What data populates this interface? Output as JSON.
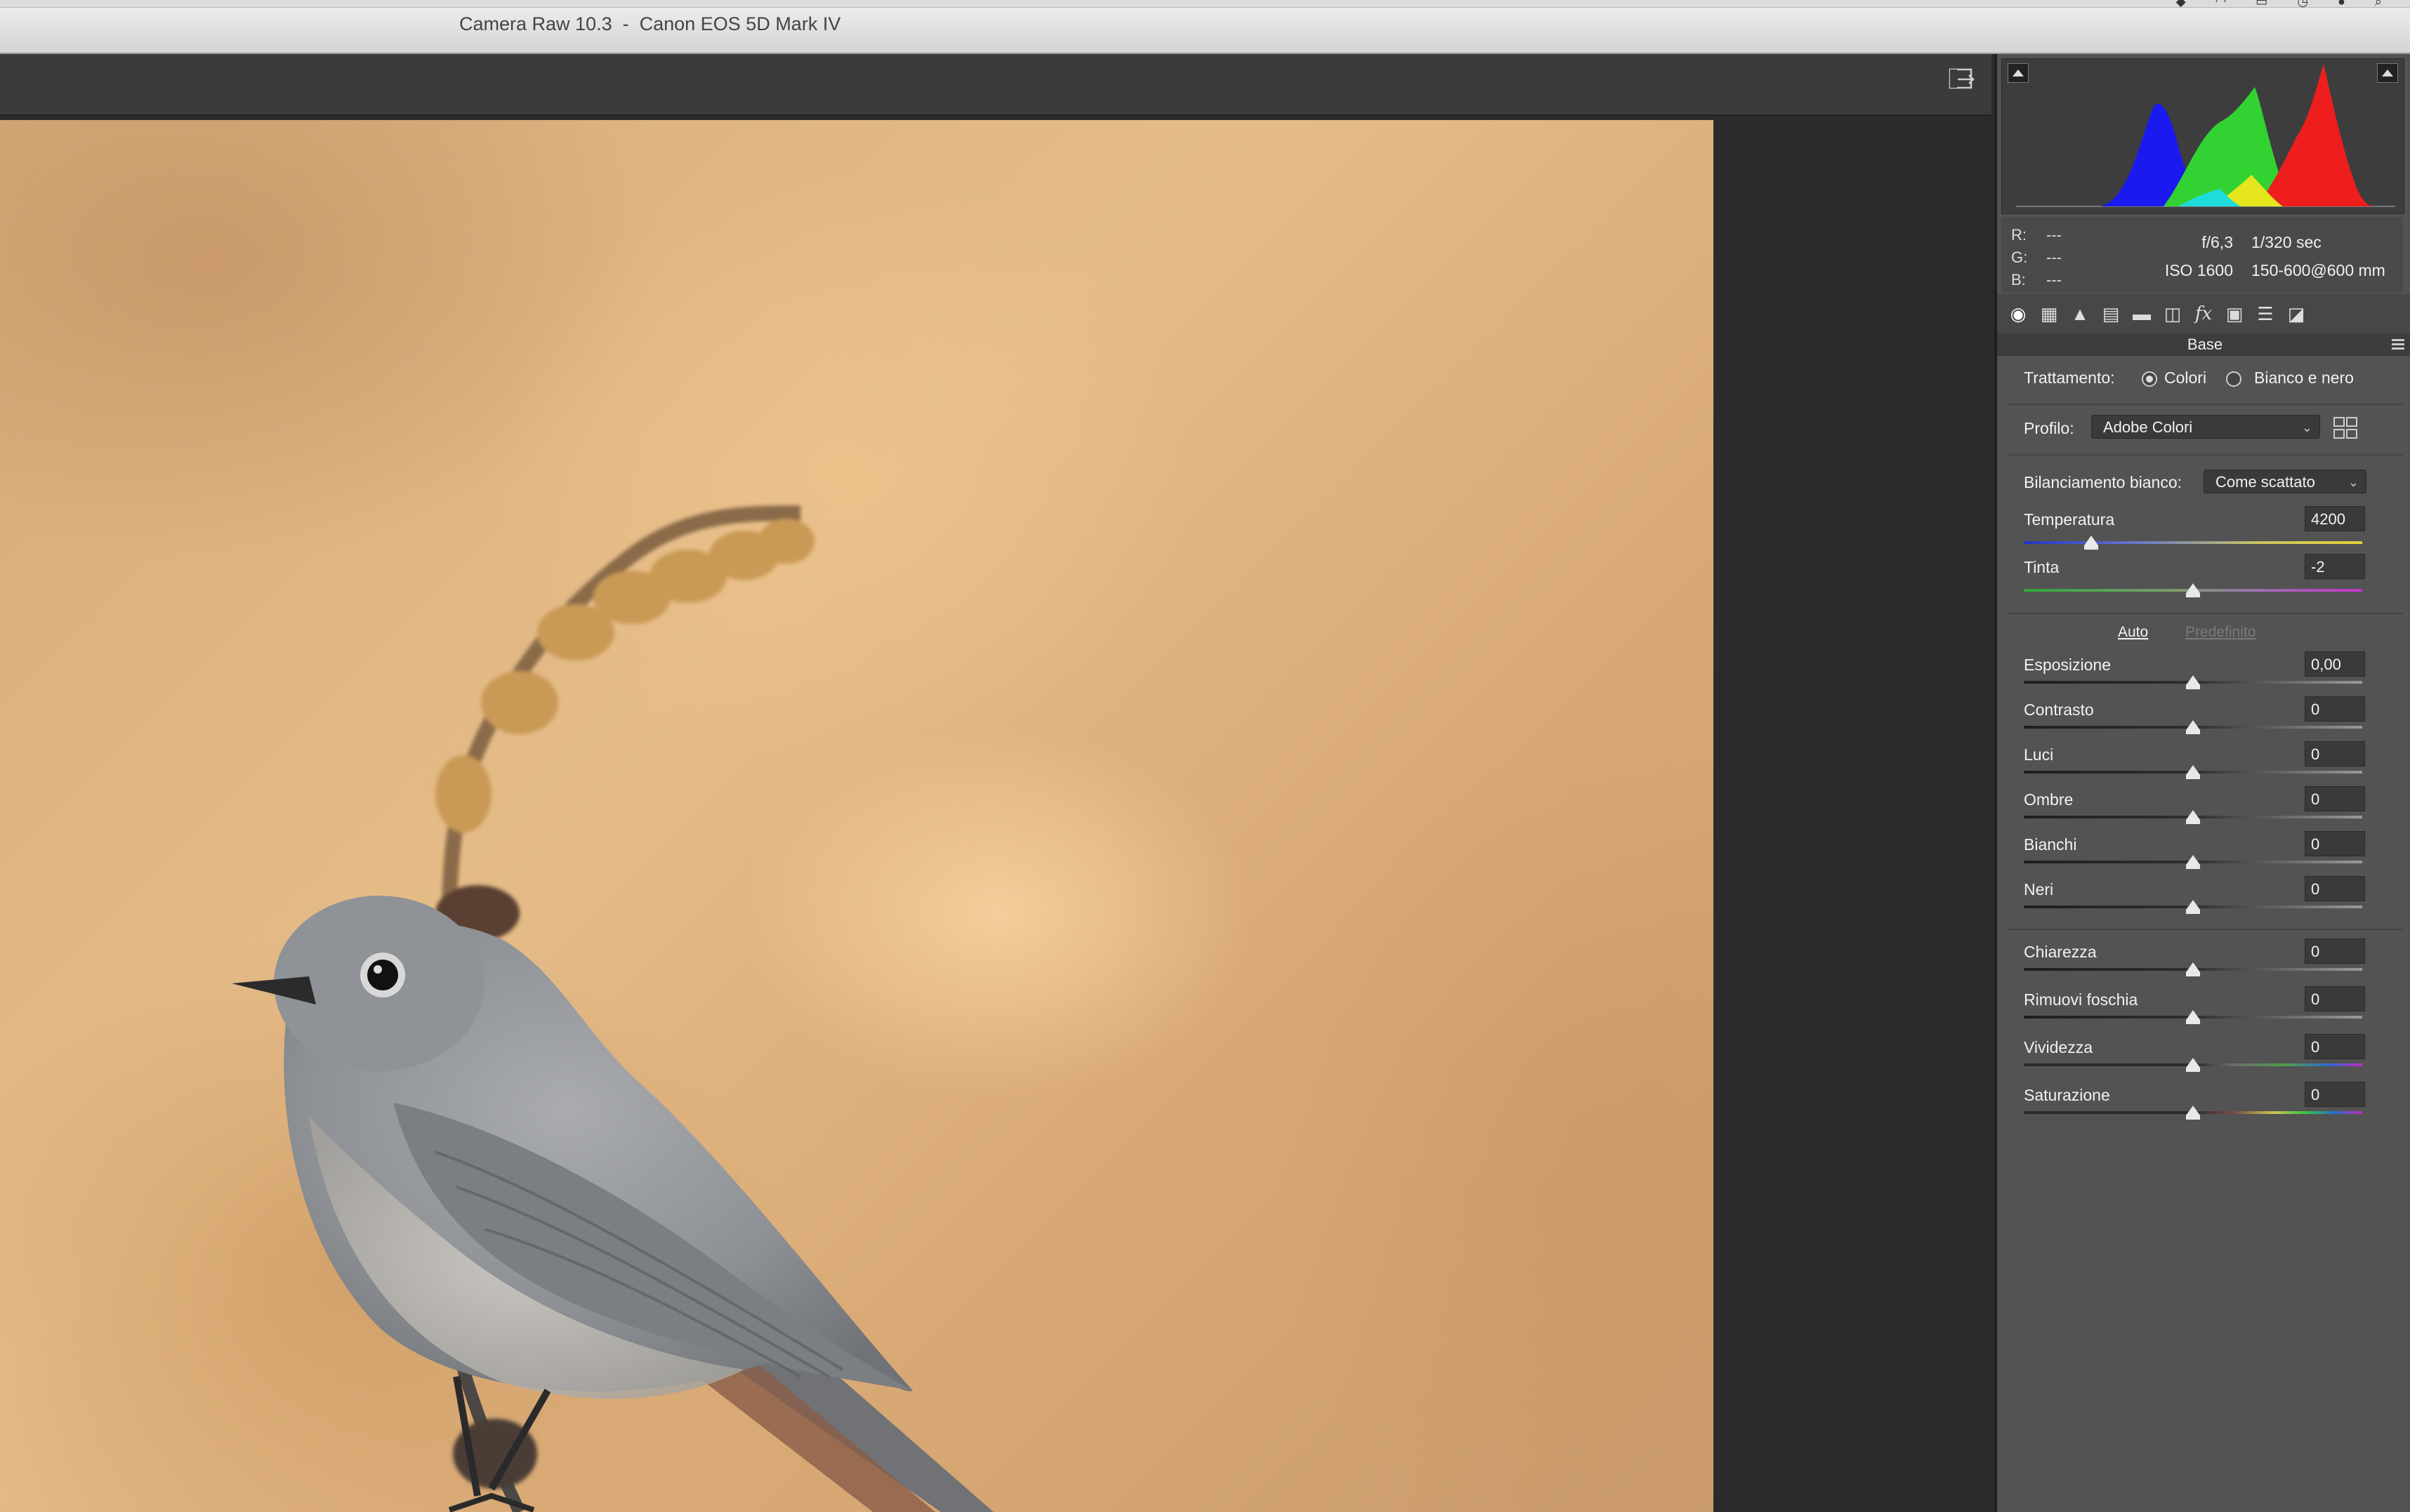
{
  "window": {
    "title": "Camera Raw 10.3  -  Canon EOS 5D Mark IV"
  },
  "histogram": {
    "info": {
      "r_label": "R:",
      "r_value": "---",
      "g_label": "G:",
      "g_value": "---",
      "b_label": "B:",
      "b_value": "---",
      "aperture": "f/6,3",
      "shutter": "1/320 sec",
      "iso": "ISO 1600",
      "lens": "150-600@600 mm"
    }
  },
  "panel": {
    "section_title": "Base",
    "tools": [
      "basic-icon",
      "tone-curve-icon",
      "detail-icon",
      "hsl-icon",
      "split-toning-icon",
      "lens-corrections-icon",
      "effects-icon",
      "camera-calibration-icon",
      "presets-icon",
      "snapshots-icon"
    ],
    "treatment": {
      "label": "Trattamento:",
      "option_color": "Colori",
      "option_bw": "Bianco e nero",
      "selected": "Colori"
    },
    "profile": {
      "label": "Profilo:",
      "value": "Adobe Colori"
    },
    "white_balance": {
      "label": "Bilanciamento bianco:",
      "value": "Come scattato"
    },
    "temperature": {
      "label": "Temperatura",
      "value": "4200",
      "position": 0.2
    },
    "tint": {
      "label": "Tinta",
      "value": "-2",
      "position": 0.5
    },
    "auto_label": "Auto",
    "default_label": "Predefinito",
    "tone": [
      {
        "label": "Esposizione",
        "value": "0,00",
        "position": 0.5
      },
      {
        "label": "Contrasto",
        "value": "0",
        "position": 0.5
      },
      {
        "label": "Luci",
        "value": "0",
        "position": 0.5
      },
      {
        "label": "Ombre",
        "value": "0",
        "position": 0.5
      },
      {
        "label": "Bianchi",
        "value": "0",
        "position": 0.5
      },
      {
        "label": "Neri",
        "value": "0",
        "position": 0.5
      }
    ],
    "presence": [
      {
        "label": "Chiarezza",
        "value": "0",
        "position": 0.5
      },
      {
        "label": "Rimuovi foschia",
        "value": "0",
        "position": 0.5
      },
      {
        "label": "Vividezza",
        "value": "0",
        "position": 0.5
      },
      {
        "label": "Saturazione",
        "value": "0",
        "position": 0.5
      }
    ]
  }
}
